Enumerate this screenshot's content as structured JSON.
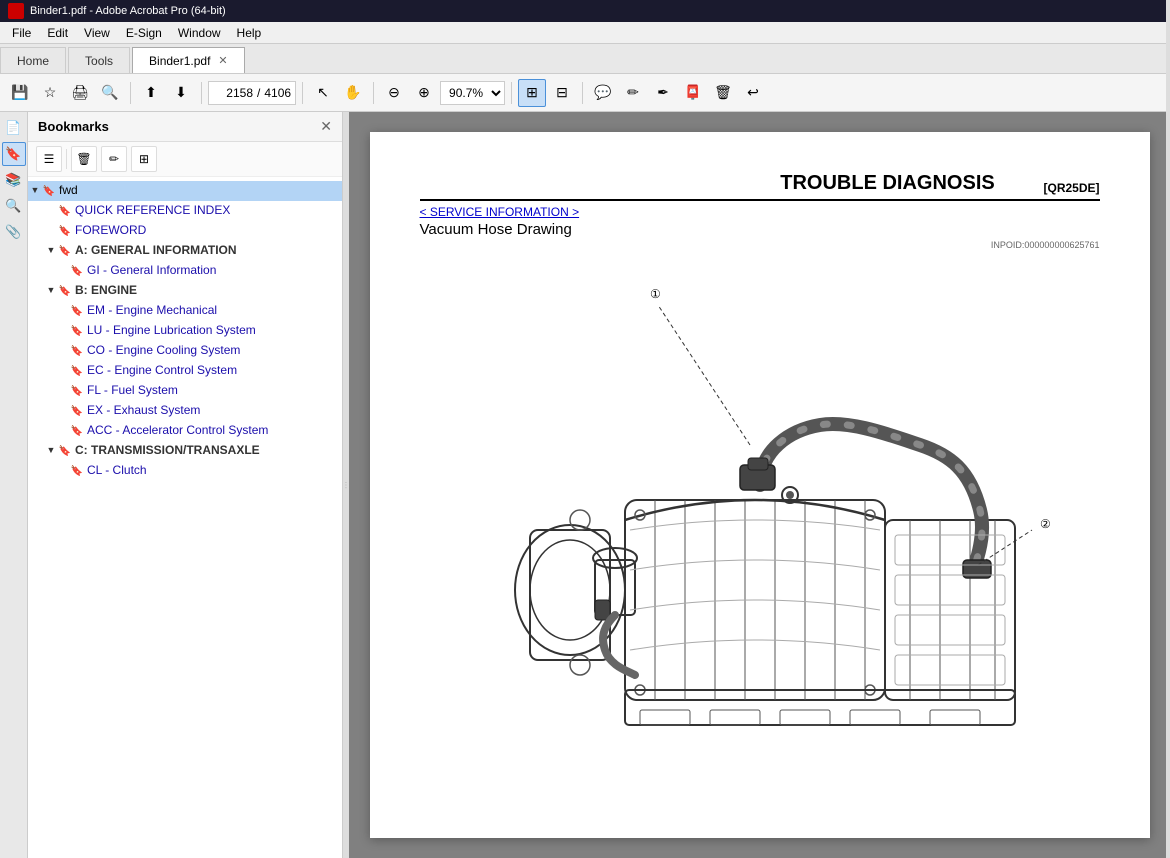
{
  "titleBar": {
    "text": "Binder1.pdf - Adobe Acrobat Pro (64-bit)"
  },
  "menuBar": {
    "items": [
      "File",
      "Edit",
      "View",
      "E-Sign",
      "Window",
      "Help"
    ]
  },
  "tabs": [
    {
      "label": "Home",
      "active": false
    },
    {
      "label": "Tools",
      "active": false
    },
    {
      "label": "Binder1.pdf",
      "active": true,
      "closable": true
    }
  ],
  "toolbar": {
    "pageNumber": "2158",
    "totalPages": "4106",
    "zoom": "90.7%"
  },
  "sidebar": {
    "title": "Bookmarks",
    "selectedItem": "fwd",
    "items": [
      {
        "id": "fwd",
        "label": "fwd",
        "indent": 0,
        "hasToggle": true,
        "expanded": true,
        "isSelected": true
      },
      {
        "id": "quick-ref",
        "label": "QUICK REFERENCE INDEX",
        "indent": 1,
        "hasToggle": false
      },
      {
        "id": "foreword",
        "label": "FOREWORD",
        "indent": 1,
        "hasToggle": false
      },
      {
        "id": "general-info-section",
        "label": "A: GENERAL INFORMATION",
        "indent": 1,
        "hasToggle": true,
        "expanded": true,
        "isBold": true
      },
      {
        "id": "gi",
        "label": "GI - General Information",
        "indent": 2,
        "hasToggle": false
      },
      {
        "id": "engine-section",
        "label": "B: ENGINE",
        "indent": 1,
        "hasToggle": true,
        "expanded": true,
        "isBold": true
      },
      {
        "id": "em",
        "label": "EM - Engine Mechanical",
        "indent": 2,
        "hasToggle": false
      },
      {
        "id": "lu",
        "label": "LU - Engine Lubrication System",
        "indent": 2,
        "hasToggle": false
      },
      {
        "id": "co",
        "label": "CO - Engine Cooling System",
        "indent": 2,
        "hasToggle": false
      },
      {
        "id": "ec",
        "label": "EC - Engine Control System",
        "indent": 2,
        "hasToggle": false
      },
      {
        "id": "fl",
        "label": "FL - Fuel System",
        "indent": 2,
        "hasToggle": false
      },
      {
        "id": "ex",
        "label": "EX - Exhaust System",
        "indent": 2,
        "hasToggle": false
      },
      {
        "id": "acc",
        "label": "ACC - Accelerator Control System",
        "indent": 2,
        "hasToggle": false
      },
      {
        "id": "trans-section",
        "label": "C: TRANSMISSION/TRANSAXLE",
        "indent": 1,
        "hasToggle": true,
        "expanded": true,
        "isBold": true
      },
      {
        "id": "cl",
        "label": "CL - Clutch",
        "indent": 2,
        "hasToggle": false
      }
    ]
  },
  "pdfContent": {
    "mainTitle": "TROUBLE DIAGNOSIS",
    "refCode": "[QR25DE]",
    "serviceInfoLink": "< SERVICE INFORMATION >",
    "sectionTitle": "Vacuum Hose Drawing",
    "inpoid": "INPOID:000000000625761"
  },
  "icons": {
    "bookmark": "🔖",
    "bookmark_outline": "⬜",
    "toggle_expand": "▼",
    "toggle_collapse": "▶",
    "chevron_right": "▶",
    "close": "✕",
    "save": "💾",
    "star": "☆",
    "print": "🖨",
    "zoom_out_small": "🔍",
    "nav_up": "⬆",
    "nav_down": "⬇",
    "cursor": "↖",
    "hand": "✋",
    "zoom_out": "⊖",
    "zoom_in": "⊕",
    "fit": "⊞",
    "organize": "⊟",
    "comment": "💬",
    "pen": "✏",
    "sign": "✒",
    "stamp": "📮",
    "delete": "🗑",
    "undo": "↩",
    "pages": "📄",
    "layers": "📚",
    "search": "🔍",
    "attach": "📎"
  }
}
